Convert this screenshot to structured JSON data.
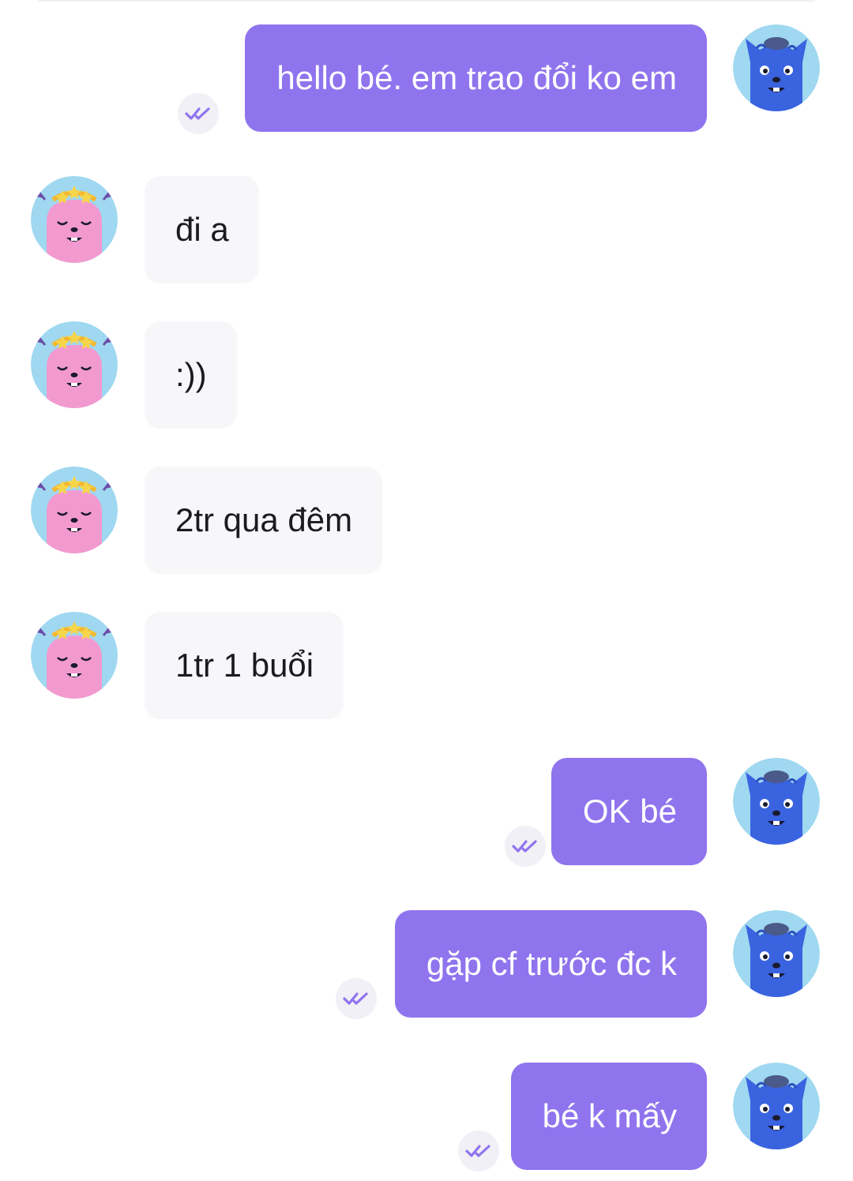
{
  "conversation": {
    "messages": [
      {
        "direction": "out",
        "text": "hello bé. em trao đổi ko em",
        "status_icon": "double-check-icon",
        "avatar": "blue-monster-avatar"
      },
      {
        "direction": "in",
        "text": "đi a",
        "avatar": "pink-monster-avatar"
      },
      {
        "direction": "in",
        "text": ":))",
        "avatar": "pink-monster-avatar"
      },
      {
        "direction": "in",
        "text": "2tr qua đêm",
        "avatar": "pink-monster-avatar"
      },
      {
        "direction": "in",
        "text": "1tr 1 buổi",
        "avatar": "pink-monster-avatar"
      },
      {
        "direction": "out",
        "text": "OK bé",
        "status_icon": "double-check-icon",
        "avatar": "blue-monster-avatar"
      },
      {
        "direction": "out",
        "text": "gặp cf trước đc k",
        "status_icon": "double-check-icon",
        "avatar": "blue-monster-avatar"
      },
      {
        "direction": "out",
        "text": "bé k mấy",
        "status_icon": "double-check-icon",
        "avatar": "blue-monster-avatar"
      }
    ]
  },
  "colors": {
    "outgoing_bubble": "#8f74ee",
    "incoming_bubble": "#f7f7fa",
    "outgoing_text": "#ffffff",
    "incoming_text": "#1b1b1f",
    "read_icon": "#8f74ee"
  }
}
